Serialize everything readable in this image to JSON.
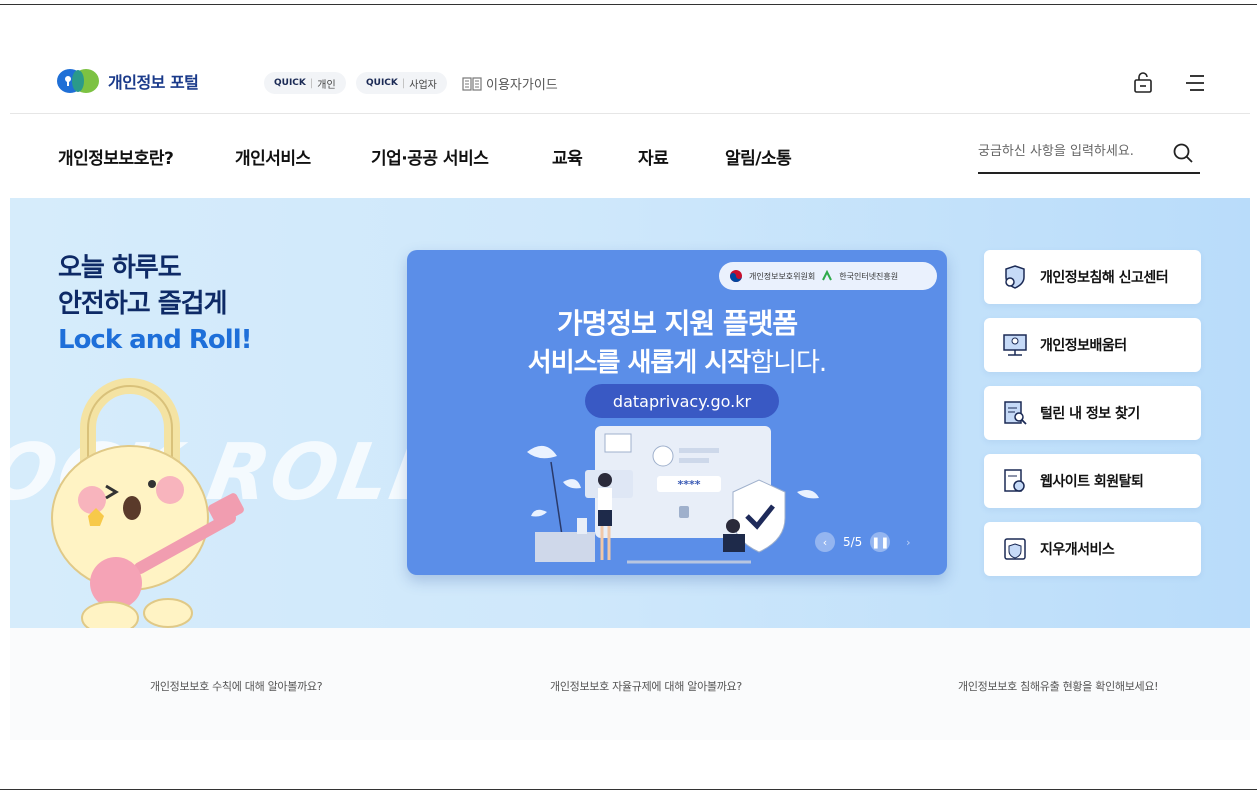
{
  "header": {
    "logo_text": "개인정보 포털",
    "quick1": {
      "tag": "QUICK",
      "label": "개인"
    },
    "quick2": {
      "tag": "QUICK",
      "label": "사업자"
    },
    "guide_label": "이용자가이드"
  },
  "nav": {
    "items": [
      "개인정보보호란?",
      "개인서비스",
      "기업·공공 서비스",
      "교육",
      "자료",
      "알림/소통"
    ],
    "search_placeholder": "궁금하신 사항을 입력하세요."
  },
  "hero": {
    "slogan_line1": "오늘 하루도",
    "slogan_line2": "안전하고 즐겁게",
    "slogan_line3": "Lock and Roll!",
    "bg_text": "OCK ROLL",
    "banner": {
      "org1": "개인정보보호위원회",
      "org2": "한국인터넷진흥원",
      "title_line1": "가명정보 지원 플랫폼",
      "title_line2_a": "서비스를 ",
      "title_line2_b": "새롭게 시작",
      "title_line2_c": "합니다.",
      "url": "dataprivacy.go.kr",
      "password_mask": "****",
      "slide_counter": "5/5"
    },
    "services": [
      "개인정보침해 신고센터",
      "개인정보배움터",
      "털린 내 정보 찾기",
      "웹사이트 회원탈퇴",
      "지우개서비스"
    ]
  },
  "bottom_links": [
    "개인정보보호 수칙에 대해 알아볼까요?",
    "개인정보보호 자율규제에 대해 알아볼까요?",
    "개인정보보호 침해유출 현황을 확인해보세요!"
  ],
  "colors": {
    "brand_navy": "#1a3a8a",
    "accent_blue": "#1e6fd9",
    "banner_bg": "#5b8ee8",
    "url_pill": "#3959c4",
    "hero_bg": "#cfe8fb"
  }
}
